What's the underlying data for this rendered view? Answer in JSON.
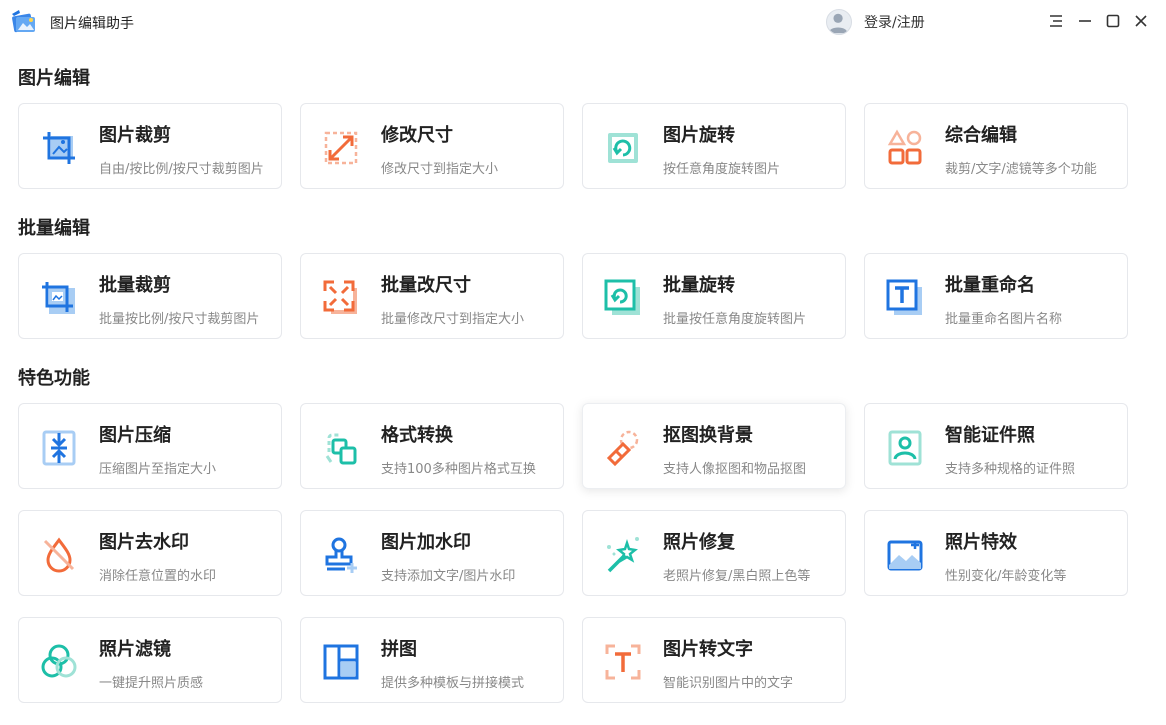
{
  "app": {
    "title": "图片编辑助手",
    "login_label": "登录/注册"
  },
  "sections": [
    {
      "title": "图片编辑",
      "items": [
        {
          "title": "图片裁剪",
          "desc": "自由/按比例/按尺寸裁剪图片",
          "icon": "crop-icon"
        },
        {
          "title": "修改尺寸",
          "desc": "修改尺寸到指定大小",
          "icon": "resize-icon"
        },
        {
          "title": "图片旋转",
          "desc": "按任意角度旋转图片",
          "icon": "rotate-icon"
        },
        {
          "title": "综合编辑",
          "desc": "裁剪/文字/滤镜等多个功能",
          "icon": "shapes-icon"
        }
      ]
    },
    {
      "title": "批量编辑",
      "items": [
        {
          "title": "批量裁剪",
          "desc": "批量按比例/按尺寸裁剪图片",
          "icon": "batch-crop-icon"
        },
        {
          "title": "批量改尺寸",
          "desc": "批量修改尺寸到指定大小",
          "icon": "batch-resize-icon"
        },
        {
          "title": "批量旋转",
          "desc": "批量按任意角度旋转图片",
          "icon": "batch-rotate-icon"
        },
        {
          "title": "批量重命名",
          "desc": "批量重命名图片名称",
          "icon": "batch-rename-icon"
        }
      ]
    },
    {
      "title": "特色功能",
      "items": [
        {
          "title": "图片压缩",
          "desc": "压缩图片至指定大小",
          "icon": "compress-icon"
        },
        {
          "title": "格式转换",
          "desc": "支持100多种图片格式互换",
          "icon": "format-convert-icon"
        },
        {
          "title": "抠图换背景",
          "desc": "支持人像抠图和物品抠图",
          "icon": "eraser-icon"
        },
        {
          "title": "智能证件照",
          "desc": "支持多种规格的证件照",
          "icon": "id-photo-icon"
        },
        {
          "title": "图片去水印",
          "desc": "消除任意位置的水印",
          "icon": "no-watermark-icon"
        },
        {
          "title": "图片加水印",
          "desc": "支持添加文字/图片水印",
          "icon": "add-watermark-icon"
        },
        {
          "title": "照片修复",
          "desc": "老照片修复/黑白照上色等",
          "icon": "magic-wand-icon"
        },
        {
          "title": "照片特效",
          "desc": "性别变化/年龄变化等",
          "icon": "photo-effect-icon"
        },
        {
          "title": "照片滤镜",
          "desc": "一键提升照片质感",
          "icon": "filter-icon"
        },
        {
          "title": "拼图",
          "desc": "提供多种模板与拼接模式",
          "icon": "collage-icon"
        },
        {
          "title": "图片转文字",
          "desc": "智能识别图片中的文字",
          "icon": "ocr-icon"
        }
      ]
    }
  ],
  "colors": {
    "blue": "#1f74e0",
    "light_blue": "#a8cdf4",
    "orange": "#f26b3a",
    "light_orange": "#f7b39a",
    "teal": "#1dbfa8",
    "light_teal": "#9fe2d6"
  }
}
